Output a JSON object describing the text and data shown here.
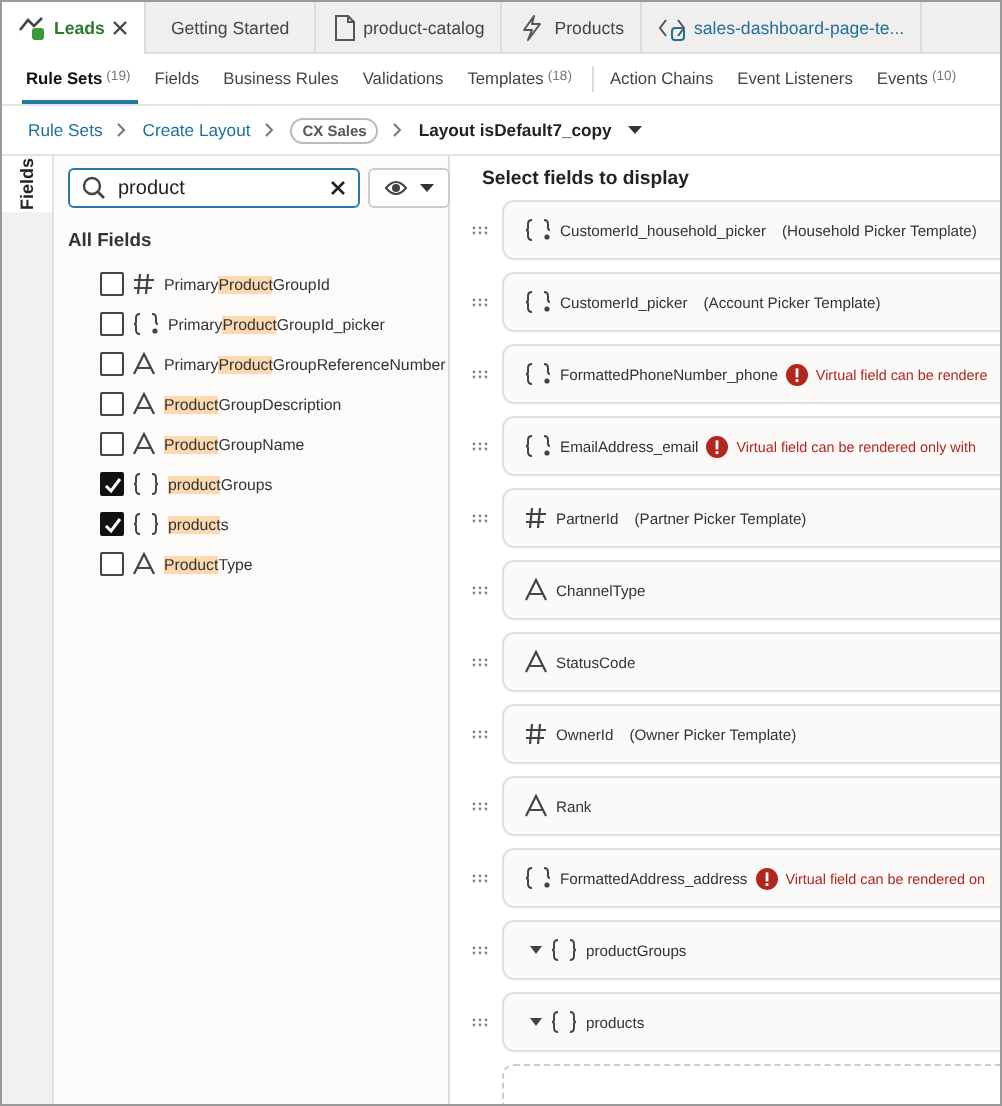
{
  "doc_tabs": [
    {
      "label": "Leads",
      "kind": "leads",
      "selected": true,
      "closable": true
    },
    {
      "label": "Getting Started",
      "kind": "plain",
      "selected": false
    },
    {
      "label": "product-catalog",
      "kind": "document",
      "selected": false
    },
    {
      "label": "Products",
      "kind": "bolt",
      "selected": false
    },
    {
      "label": "sales-dashboard-page-te...",
      "kind": "code",
      "selected": false,
      "link": true
    }
  ],
  "nav_tabs": [
    {
      "label": "Rule Sets",
      "count": "(19)",
      "selected": true
    },
    {
      "label": "Fields",
      "selected": false
    },
    {
      "label": "Business Rules",
      "selected": false
    },
    {
      "label": "Validations",
      "selected": false
    },
    {
      "label": "Templates",
      "count": "(18)",
      "selected": false,
      "divider_after": true
    },
    {
      "label": "Action Chains",
      "selected": false
    },
    {
      "label": "Event Listeners",
      "selected": false
    },
    {
      "label": "Events",
      "count": "(10)",
      "selected": false
    }
  ],
  "breadcrumb": {
    "links": [
      "Rule Sets",
      "Create Layout"
    ],
    "badge": "CX Sales",
    "current": "Layout isDefault7_copy"
  },
  "side_tab": {
    "label": "Fields",
    "selected": true
  },
  "search": {
    "value": "product"
  },
  "field_list": {
    "heading": "All Fields",
    "items": [
      {
        "kind": "number",
        "before": "Primary",
        "match": "Product",
        "after": "GroupId",
        "checked": false
      },
      {
        "kind": "picker",
        "before": "Primary",
        "match": "Product",
        "after": "GroupId_picker",
        "checked": false
      },
      {
        "kind": "text",
        "before": "Primary",
        "match": "Product",
        "after": "GroupReferenceNumber",
        "checked": false
      },
      {
        "kind": "text",
        "match": "Product",
        "after": "GroupDescription",
        "checked": false
      },
      {
        "kind": "text",
        "match": "Product",
        "after": "GroupName",
        "checked": false
      },
      {
        "kind": "object",
        "match": "product",
        "after": "Groups",
        "checked": true
      },
      {
        "kind": "object",
        "match": "product",
        "after": "s",
        "checked": true
      },
      {
        "kind": "text",
        "match": "Product",
        "after": "Type",
        "checked": false
      }
    ]
  },
  "display": {
    "heading": "Select fields to display",
    "rows": [
      {
        "kind": "picker",
        "name": "CustomerId_household_picker",
        "template": "(Household Picker Template)"
      },
      {
        "kind": "picker",
        "name": "CustomerId_picker",
        "template": "(Account Picker Template)"
      },
      {
        "kind": "picker",
        "name": "FormattedPhoneNumber_phone",
        "warning": "Virtual field can be rendere"
      },
      {
        "kind": "picker",
        "name": "EmailAddress_email",
        "warning": "Virtual field can be rendered only with"
      },
      {
        "kind": "number",
        "name": "PartnerId",
        "template": "(Partner Picker Template)"
      },
      {
        "kind": "text",
        "name": "ChannelType"
      },
      {
        "kind": "text",
        "name": "StatusCode"
      },
      {
        "kind": "number",
        "name": "OwnerId",
        "template": "(Owner Picker Template)"
      },
      {
        "kind": "text",
        "name": "Rank"
      },
      {
        "kind": "picker",
        "name": "FormattedAddress_address",
        "warning": "Virtual field can be rendered on"
      },
      {
        "kind": "object",
        "name": "productGroups",
        "expanded": true
      },
      {
        "kind": "object",
        "name": "products",
        "expanded": true
      }
    ]
  }
}
